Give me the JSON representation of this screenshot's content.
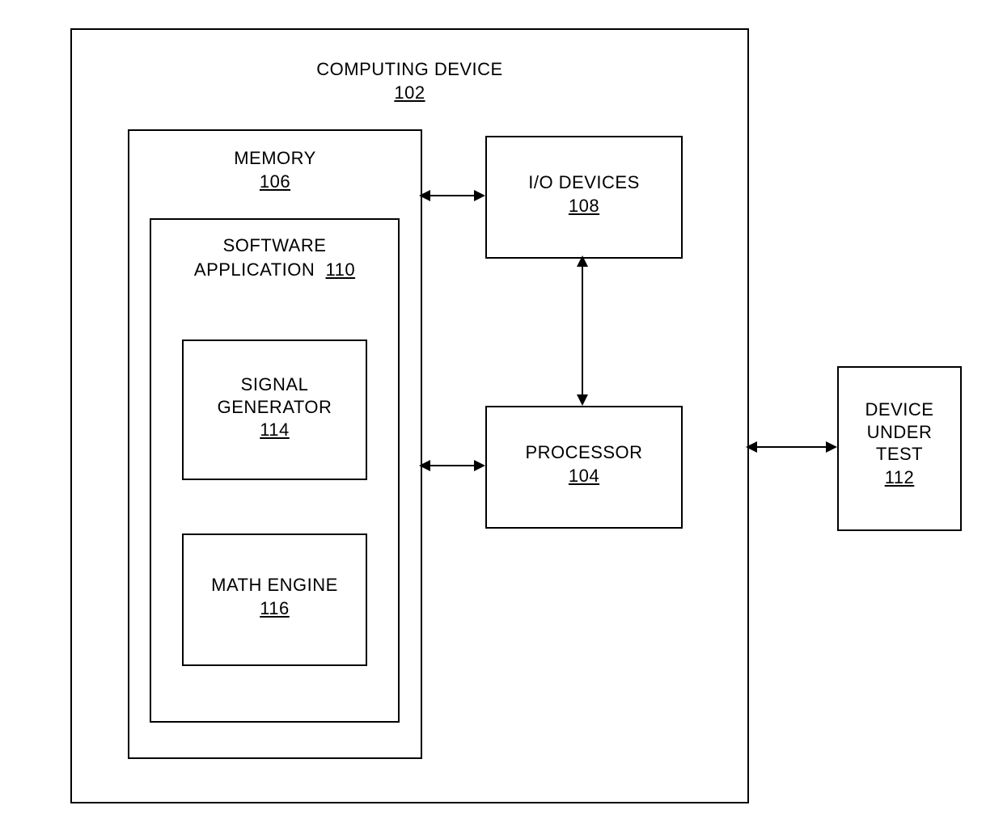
{
  "computing_device": {
    "label": "COMPUTING DEVICE",
    "ref": "102"
  },
  "memory": {
    "label": "MEMORY",
    "ref": "106"
  },
  "software_app": {
    "label_line1": "SOFTWARE",
    "label_line2": "APPLICATION",
    "ref": "110"
  },
  "signal_generator": {
    "label_line1": "SIGNAL",
    "label_line2": "GENERATOR",
    "ref": "114"
  },
  "math_engine": {
    "label": "MATH ENGINE",
    "ref": "116"
  },
  "io_devices": {
    "label": "I/O DEVICES",
    "ref": "108"
  },
  "processor": {
    "label": "PROCESSOR",
    "ref": "104"
  },
  "device_under_test": {
    "label_line1": "DEVICE",
    "label_line2": "UNDER",
    "label_line3": "TEST",
    "ref": "112"
  }
}
